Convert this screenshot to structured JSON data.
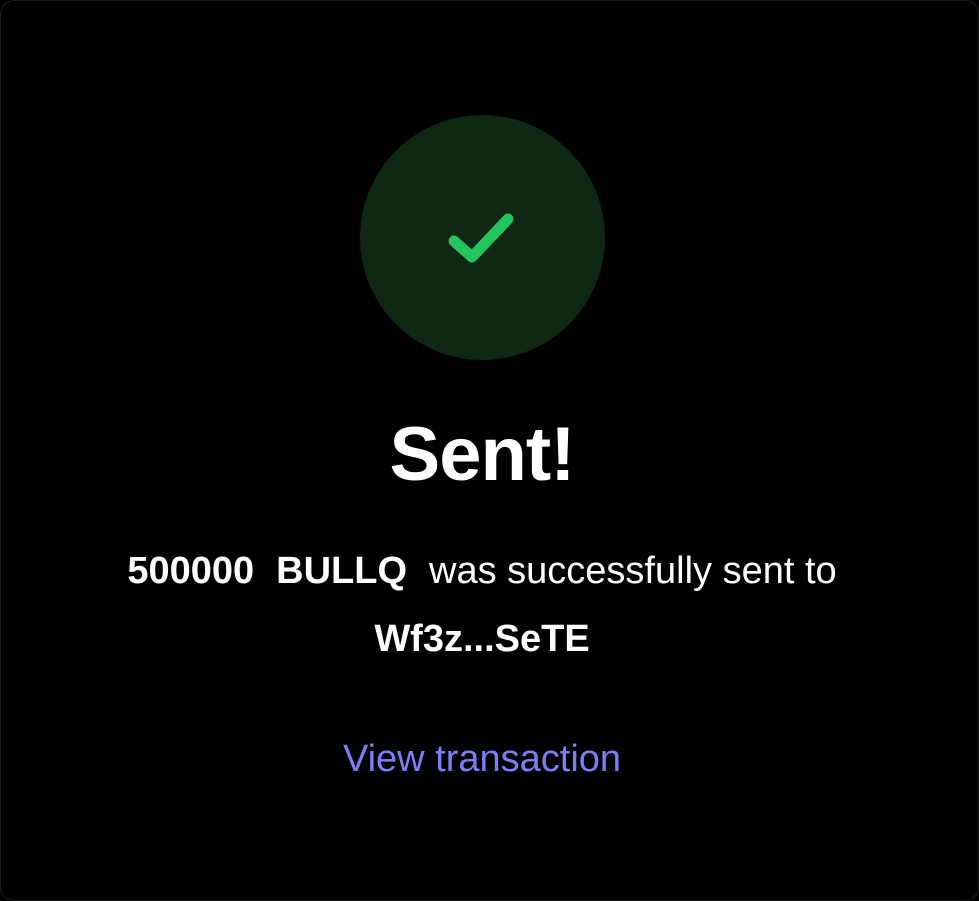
{
  "status": {
    "icon": "check-icon",
    "title": "Sent!"
  },
  "transfer": {
    "amount": "500000",
    "token": "BULLQ",
    "message_suffix": "was successfully sent to",
    "recipient": "Wf3z...SeTE"
  },
  "actions": {
    "view_transaction_label": "View transaction"
  },
  "colors": {
    "background": "#000000",
    "success_circle": "#0e2814",
    "check": "#22c55e",
    "link": "#7b7ff5",
    "text": "#ffffff"
  }
}
